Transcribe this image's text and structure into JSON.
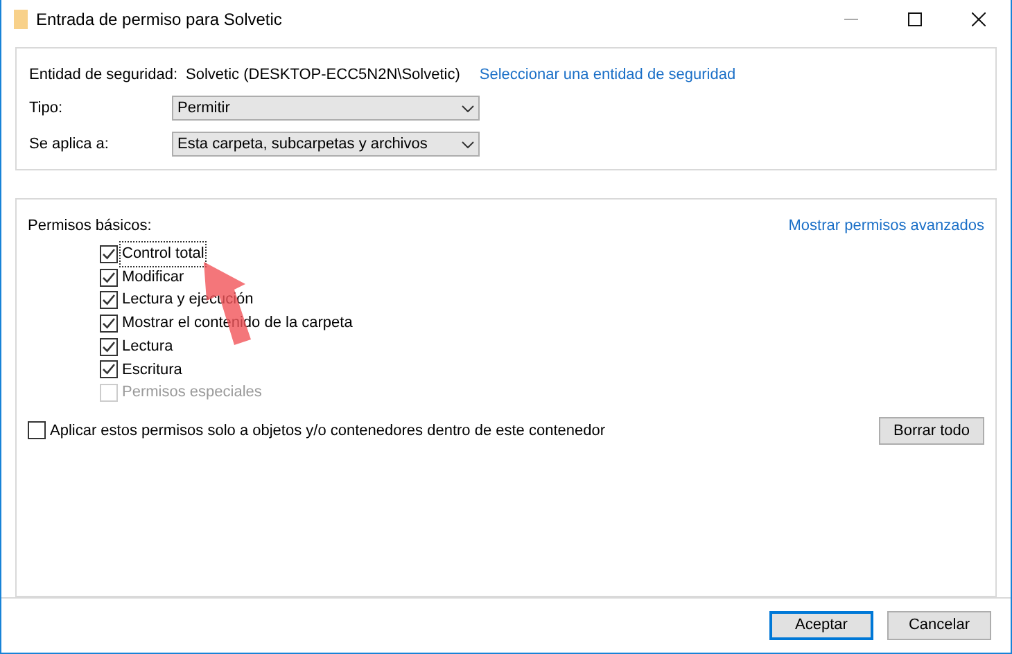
{
  "window": {
    "title": "Entrada de permiso para Solvetic"
  },
  "principal": {
    "label": "Entidad de seguridad:",
    "value": "Solvetic (DESKTOP-ECC5N2N\\Solvetic)",
    "link": "Seleccionar una entidad de seguridad"
  },
  "fields": [
    {
      "label": "Tipo:",
      "value": "Permitir"
    },
    {
      "label": "Se aplica a:",
      "value": "Esta carpeta, subcarpetas y archivos"
    }
  ],
  "permissions": {
    "title": "Permisos básicos:",
    "link": "Mostrar permisos avanzados",
    "items": [
      {
        "label": "Control total",
        "checked": true,
        "disabled": false,
        "focused": true
      },
      {
        "label": "Modificar",
        "checked": true,
        "disabled": false,
        "focused": false
      },
      {
        "label": "Lectura y ejecución",
        "checked": true,
        "disabled": false,
        "focused": false
      },
      {
        "label": "Mostrar el contenido de la carpeta",
        "checked": true,
        "disabled": false,
        "focused": false
      },
      {
        "label": "Lectura",
        "checked": true,
        "disabled": false,
        "focused": false
      },
      {
        "label": "Escritura",
        "checked": true,
        "disabled": false,
        "focused": false
      },
      {
        "label": "Permisos especiales",
        "checked": false,
        "disabled": true,
        "focused": false
      }
    ],
    "apply_only": {
      "label": "Aplicar estos permisos solo a objetos y/o contenedores dentro de este contenedor",
      "checked": false
    },
    "clear_button": "Borrar todo"
  },
  "buttons": [
    {
      "label": "Aceptar",
      "default": true
    },
    {
      "label": "Cancelar",
      "default": false
    }
  ]
}
